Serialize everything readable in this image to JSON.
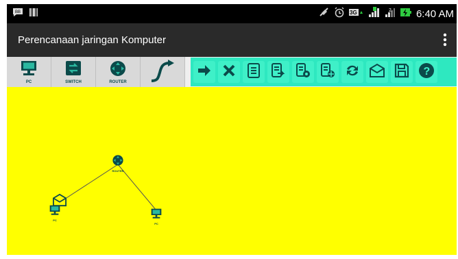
{
  "status_bar": {
    "time": "6:40 AM",
    "network_label": "3G"
  },
  "app_bar": {
    "title": "Perencanaan jaringan Komputer"
  },
  "toolbar": {
    "tools": [
      {
        "label": "PC",
        "icon": "pc-icon"
      },
      {
        "label": "SWITCH",
        "icon": "switch-icon"
      },
      {
        "label": "ROUTER",
        "icon": "router-icon"
      },
      {
        "label": "",
        "icon": "cable-icon"
      }
    ],
    "actions": [
      {
        "icon": "arrow-right-icon"
      },
      {
        "icon": "delete-icon"
      },
      {
        "icon": "document-list-icon"
      },
      {
        "icon": "document-export-icon"
      },
      {
        "icon": "document-settings-icon"
      },
      {
        "icon": "document-config-icon"
      },
      {
        "icon": "refresh-icon"
      },
      {
        "icon": "mail-icon"
      },
      {
        "icon": "save-icon"
      },
      {
        "icon": "help-icon"
      }
    ]
  },
  "canvas": {
    "background": "#ffff00",
    "nodes": [
      {
        "label": "ROUTER",
        "type": "router"
      },
      {
        "label": "PC",
        "type": "pc"
      },
      {
        "label": "PC",
        "type": "pc"
      }
    ]
  },
  "colors": {
    "accent": "#2ee8c0",
    "icon": "#0b4a4a",
    "canvas": "#ffff00"
  }
}
